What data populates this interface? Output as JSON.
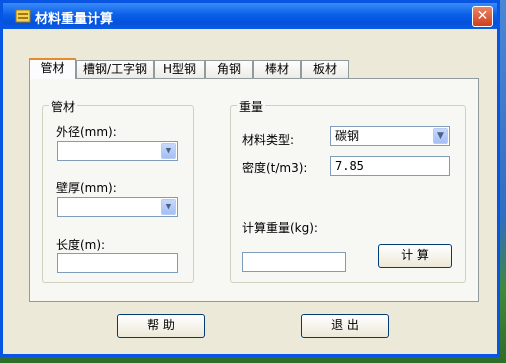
{
  "window": {
    "title": "材料重量计算",
    "close_label": "✕"
  },
  "tabs": [
    "管材",
    "槽钢/工字钢",
    "H型钢",
    "角钢",
    "棒材",
    "板材"
  ],
  "pipe_group": {
    "label": "管材",
    "outer_diameter_label": "外径(mm):",
    "outer_diameter_value": "",
    "wall_thickness_label": "壁厚(mm):",
    "wall_thickness_value": "",
    "length_label": "长度(m):",
    "length_value": ""
  },
  "weight_group": {
    "label": "重量",
    "material_type_label": "材料类型:",
    "material_type_value": "碳钢",
    "density_label": "密度(t/m3):",
    "density_value": "7.85",
    "result_label": "计算重量(kg):",
    "result_value": "",
    "calculate_button": "计 算"
  },
  "footer": {
    "help_button": "帮 助",
    "exit_button": "退 出"
  },
  "icons": {
    "title": "app-icon",
    "dropdown": "chevron-down-icon",
    "close": "close-icon"
  }
}
